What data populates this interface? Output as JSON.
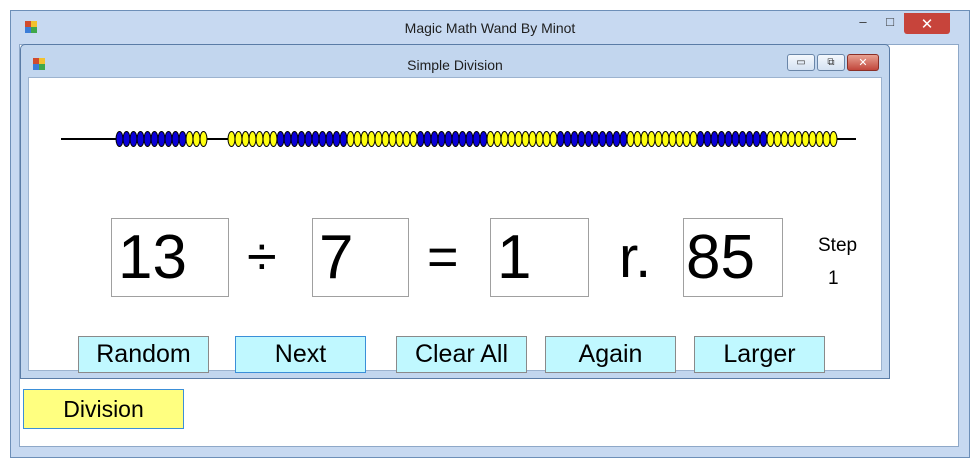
{
  "app": {
    "title": "Magic Math Wand By Minot",
    "minimize_glyph": "–",
    "maximize_glyph": "□",
    "close_glyph": "✕"
  },
  "child_window": {
    "title": "Simple Division",
    "minimize_glyph": "▭",
    "restore_glyph": "⧉",
    "close_glyph": "✕"
  },
  "beads": {
    "colors": {
      "blue": "#0a00d8",
      "yellow": "#ffff10",
      "outline": "#000000"
    },
    "groups": [
      {
        "color": "blue",
        "count": 10
      },
      {
        "color": "yellow",
        "count": 3
      },
      {
        "color": "gap",
        "count": 1
      },
      {
        "color": "yellow",
        "count": 7
      },
      {
        "color": "blue",
        "count": 10
      },
      {
        "color": "yellow",
        "count": 10
      },
      {
        "color": "blue",
        "count": 10
      },
      {
        "color": "yellow",
        "count": 10
      },
      {
        "color": "blue",
        "count": 10
      },
      {
        "color": "yellow",
        "count": 10
      },
      {
        "color": "blue",
        "count": 10
      },
      {
        "color": "yellow",
        "count": 10
      }
    ]
  },
  "equation": {
    "dividend": "13",
    "divide_sign": "÷",
    "divisor": "7",
    "equals_sign": "=",
    "quotient": "1",
    "remainder_label": "r.",
    "remainder": "85"
  },
  "step": {
    "label": "Step",
    "value": "1"
  },
  "buttons": {
    "random": "Random",
    "next": "Next",
    "clear_all": "Clear All",
    "again": "Again",
    "larger": "Larger"
  },
  "mode": {
    "division": "Division"
  },
  "colors": {
    "button_bg": "#c0f8ff",
    "mode_button_bg": "#ffff80",
    "focus_border": "#3b8fd8"
  }
}
